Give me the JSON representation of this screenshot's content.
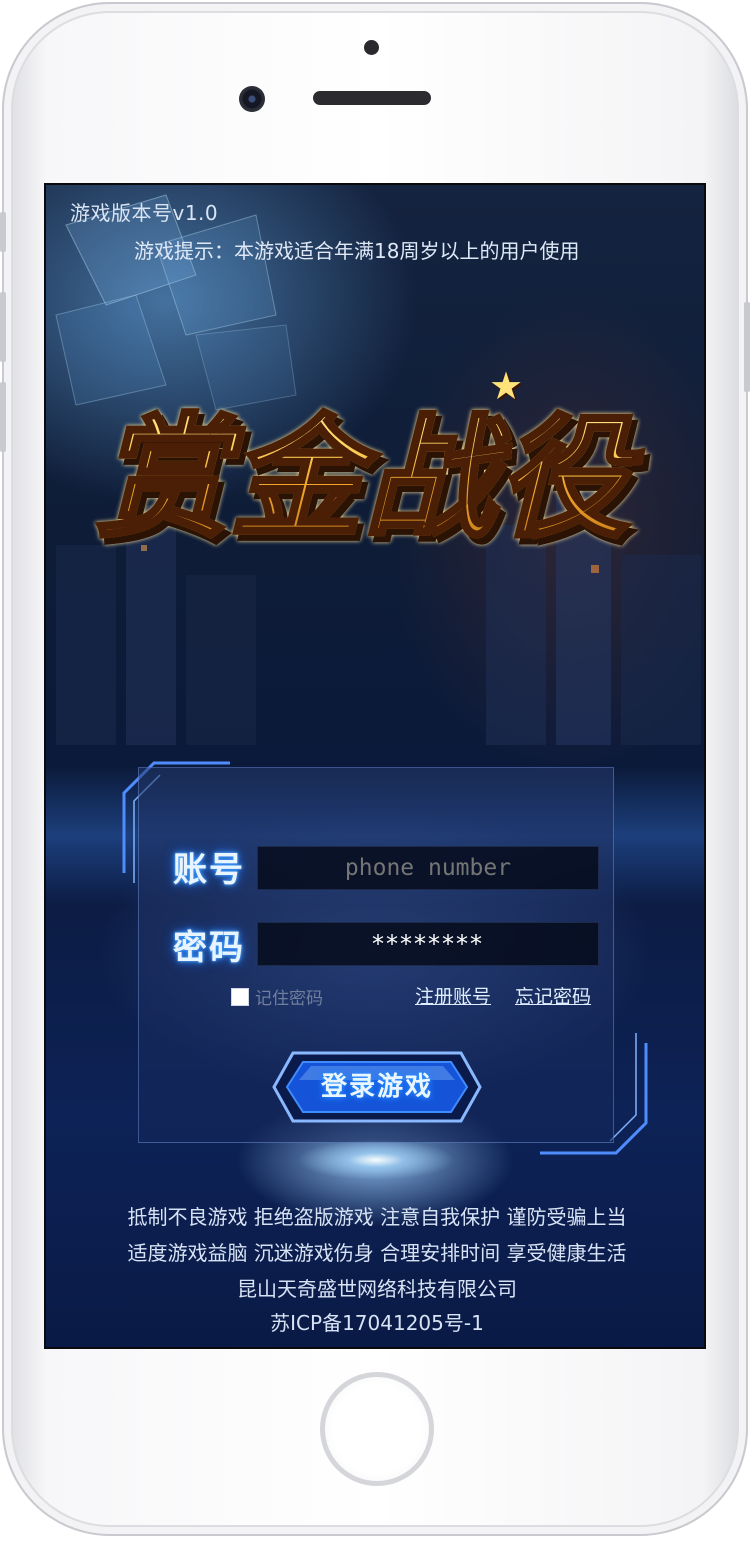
{
  "header": {
    "version": "游戏版本号v1.0",
    "tip": "游戏提示：本游戏适合年满18周岁以上的用户使用"
  },
  "logo": {
    "title": "赏金战役"
  },
  "login": {
    "account_label": "账号",
    "account_placeholder": "phone number",
    "password_label": "密码",
    "password_value": "********",
    "remember_label": "记住密码",
    "remember_checked": false,
    "register_link": "注册账号",
    "forgot_link": "忘记密码",
    "login_button": "登录游戏"
  },
  "footer": {
    "line1": "抵制不良游戏 拒绝盗版游戏 注意自我保护 谨防受骗上当",
    "line2": "适度游戏益脑 沉迷游戏伤身 合理安排时间 享受健康生活",
    "company": "昆山天奇盛世网络科技有限公司",
    "icp": "苏ICP备17041205号-1"
  },
  "colors": {
    "accent_blue": "#3aa0ff",
    "logo_gold": "#f7c948",
    "background": "#0b1a3a"
  },
  "icons": [
    "camera-icon",
    "speaker-icon",
    "home-button",
    "checkbox-icon"
  ]
}
